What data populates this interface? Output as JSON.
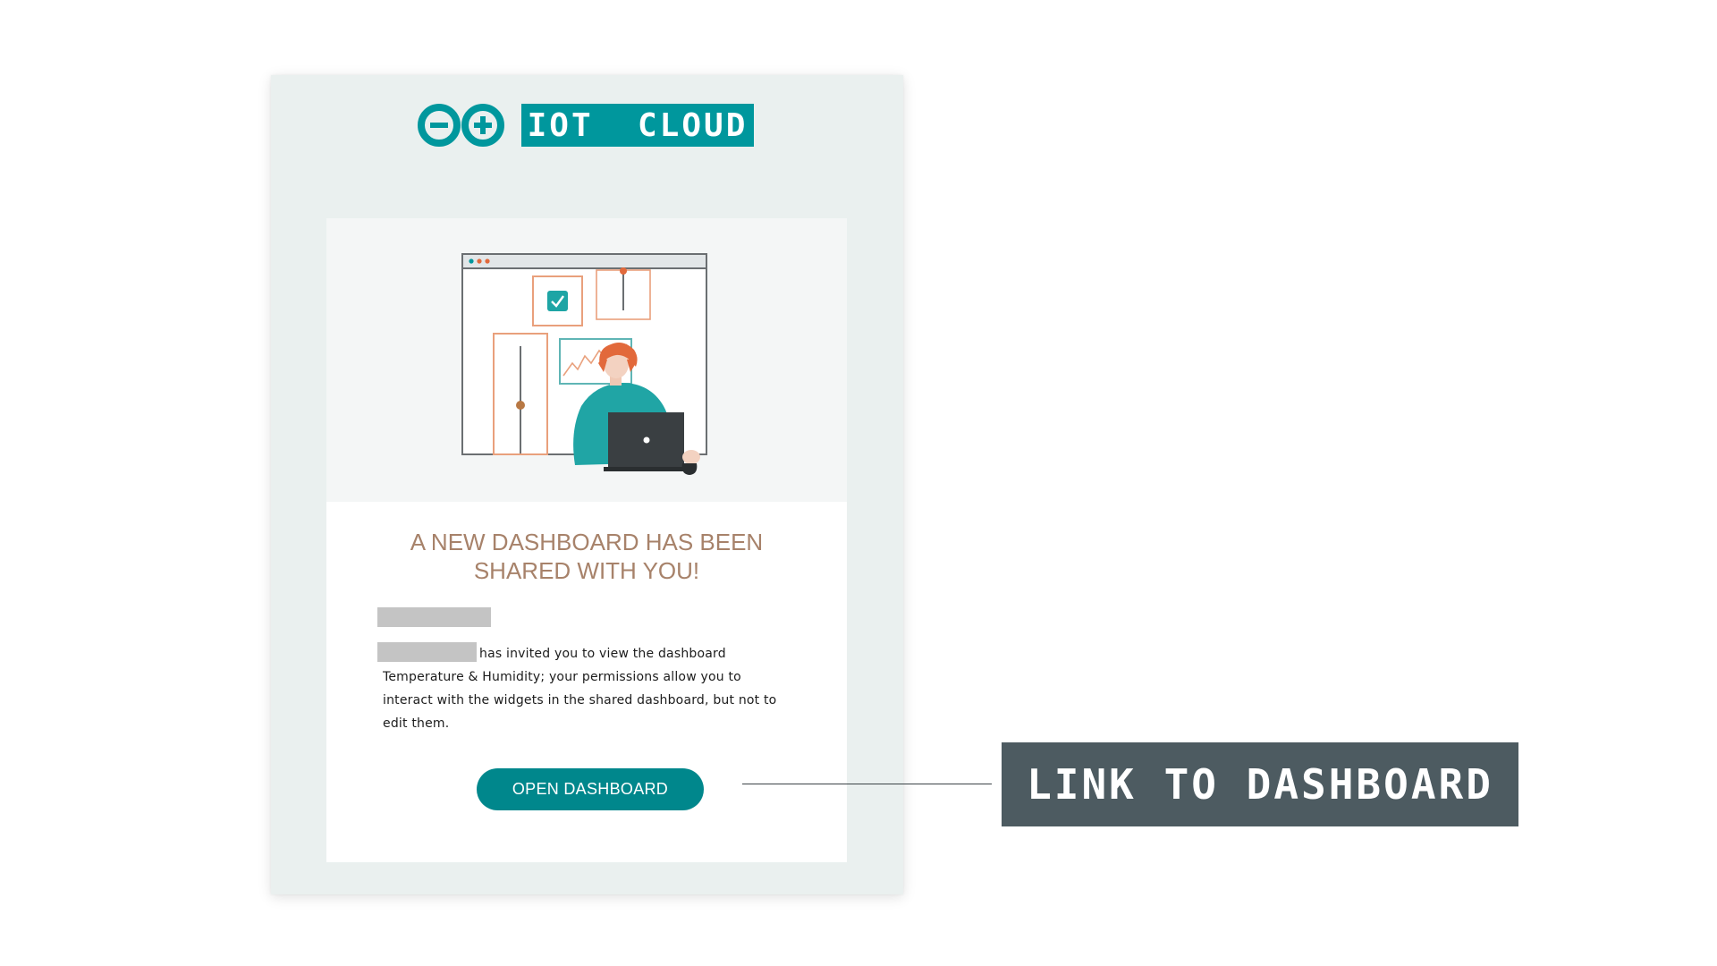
{
  "brand": {
    "logo_icon": "arduino-infinity-logo",
    "name": "IOT  CLOUD",
    "color": "#00979d"
  },
  "email": {
    "hero_icon": "dashboard-user-illustration",
    "headline_line1": "A NEW DASHBOARD HAS BEEN",
    "headline_line2": "SHARED WITH YOU!",
    "body_line1": "has invited you to view the dashboard",
    "body_line2": "Temperature & Humidity; your permissions allow you to",
    "body_line3": "interact with the widgets in the shared dashboard, but not to",
    "body_line4": "edit them.",
    "button_label": "OPEN DASHBOARD",
    "button_color": "#00878c",
    "headline_color": "#a7826a"
  },
  "annotation": {
    "label": "LINK TO DASHBOARD",
    "background": "#4d5b61"
  }
}
